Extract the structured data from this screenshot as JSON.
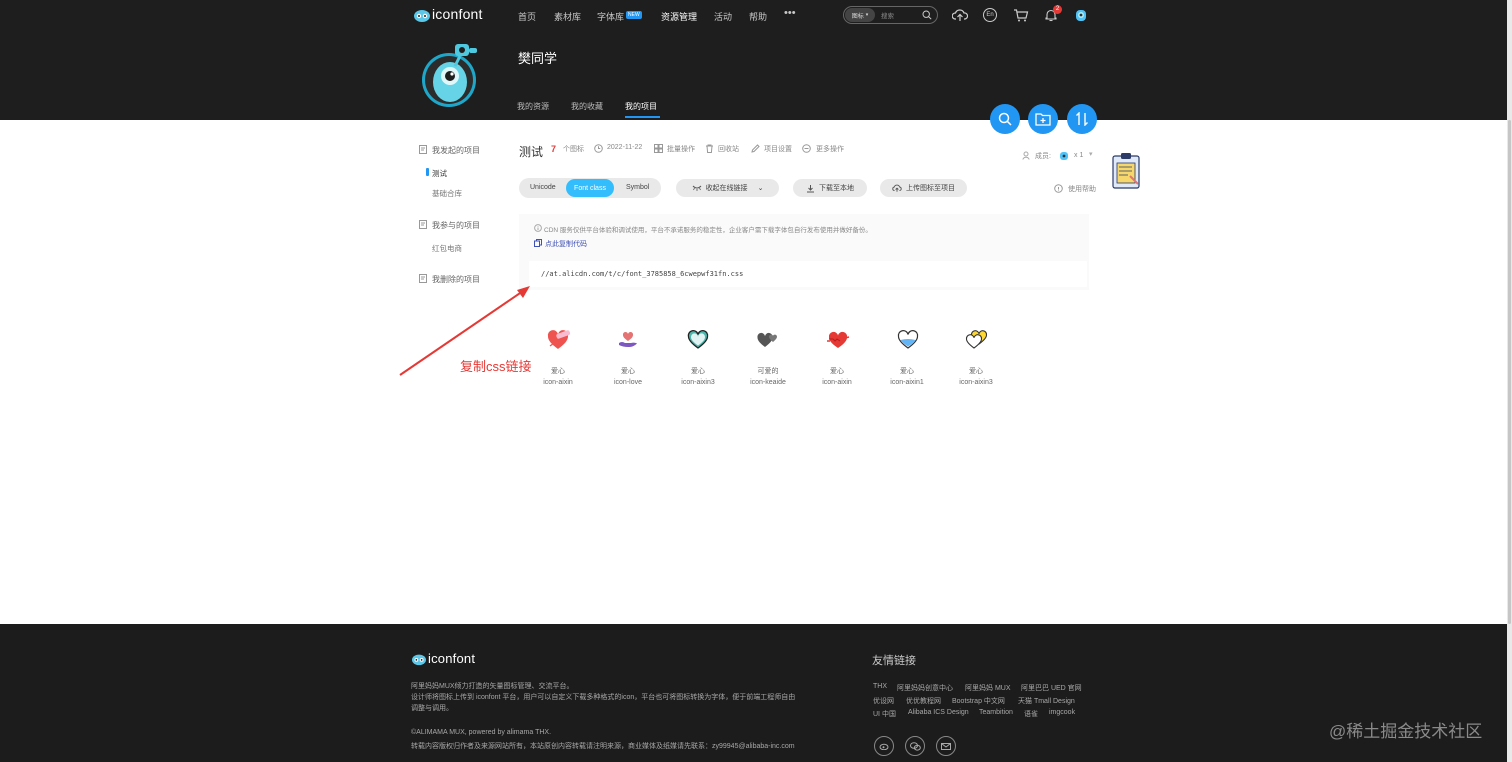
{
  "header": {
    "logo_text": "iconfont",
    "nav": [
      "首页",
      "素材库",
      "字体库",
      "资源管理",
      "活动",
      "帮助"
    ],
    "new_badge": "NEW",
    "more": "•••",
    "search_scope": "图标",
    "search_placeholder": "搜索",
    "lang_label": "En",
    "notification_count": "2"
  },
  "profile": {
    "username": "樊同学",
    "tabs": [
      "我的资源",
      "我的收藏",
      "我的项目"
    ]
  },
  "sidebar": {
    "sections": [
      {
        "title": "我发起的项目",
        "items": [
          "测试",
          "基础合库"
        ]
      },
      {
        "title": "我参与的项目",
        "items": [
          "红包电商"
        ]
      },
      {
        "title": "我删除的项目",
        "items": []
      }
    ]
  },
  "project": {
    "name": "测试",
    "count": "7",
    "count_unit": "个图标",
    "date": "2022-11-22",
    "batch": "批量操作",
    "recycle": "回收站",
    "settings": "项目设置",
    "more": "更多操作",
    "members_label": "成员:",
    "members_count": "x 1",
    "help": "使用帮助"
  },
  "toolbar": {
    "formats": [
      "Unicode",
      "Font class",
      "Symbol"
    ],
    "active_format": "Font class",
    "collapse": "收起在线链接",
    "download": "下载至本地",
    "upload": "上传图标至项目"
  },
  "cdn": {
    "notice": "CDN 服务仅供平台体验和调试使用，平台不承诺服务的稳定性，企业客户需下载字体包自行发布使用并做好备份。",
    "copy_link": "点此复制代码",
    "url": "//at.alicdn.com/t/c/font_3785858_6cwepwf31fn.css"
  },
  "annotation": {
    "text": "复制css链接",
    "color": "#e53935"
  },
  "icons": [
    {
      "name": "爱心",
      "code": "icon-aixin",
      "icon": "heart-bandaid-icon"
    },
    {
      "name": "爱心",
      "code": "icon-love",
      "icon": "heart-hand-icon"
    },
    {
      "name": "爱心",
      "code": "icon-aixin3",
      "icon": "heart-outline-green-icon"
    },
    {
      "name": "可爱的",
      "code": "icon-keaide",
      "icon": "double-heart-icon"
    },
    {
      "name": "爱心",
      "code": "icon-aixin",
      "icon": "heart-puzzle-icon"
    },
    {
      "name": "爱心",
      "code": "icon-aixin1",
      "icon": "heart-blue-icon"
    },
    {
      "name": "爱心",
      "code": "icon-aixin3",
      "icon": "heart-yellow-icon"
    }
  ],
  "footer": {
    "logo_text": "iconfont",
    "desc1": "阿里妈妈MUX倾力打造的矢量图标管理、交流平台。",
    "desc2": "设计师将图标上传到 iconfont 平台，用户可以自定义下载多种格式的icon，平台也可将图标转换为字体，便于前端工程师自由调整与调用。",
    "copyright": "©ALIMAMA MUX, powered by alimama THX.",
    "contact": "转载内容版权归作者及来源网站所有，本站原创内容转载请注明来源，商业媒体及纸媒请先联系：zy99945@alibaba-inc.com",
    "friends_title": "友情链接",
    "links_row1": [
      "THX",
      "阿里妈妈创意中心",
      "阿里妈妈 MUX",
      "阿里巴巴 UED 官网"
    ],
    "links_row2": [
      "优设网",
      "优优教程网",
      "Bootstrap 中文网",
      "天猫 Tmall Design"
    ],
    "links_row3": [
      "UI 中国",
      "Alibaba ICS Design",
      "Teambition",
      "语雀",
      "imgcook"
    ],
    "watermark": "@稀土掘金技术社区"
  },
  "colors": {
    "header_bg": "#1e1e1e",
    "accent_blue": "#2196f3",
    "active_format": "#33bdfd",
    "project_count": "#e53935"
  }
}
